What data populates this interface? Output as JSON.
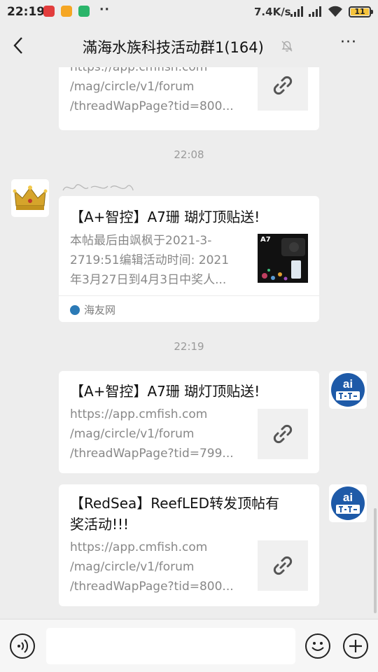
{
  "status_bar": {
    "time": "22:19",
    "more_dots": "··",
    "net_speed": "7.4K/s",
    "battery_level": "11"
  },
  "header": {
    "title": "滿海水族科技活动群1(164)",
    "more_label": "···"
  },
  "messages": [
    {
      "type": "link",
      "title": "",
      "desc_lines": [
        "https://app.cmfish.com",
        "/mag/circle/v1/forum",
        "/threadWapPage?tid=800..."
      ]
    },
    {
      "type": "time",
      "text": "22:08"
    },
    {
      "type": "article",
      "title": "【A+智控】A7珊 瑚灯顶贴送!",
      "desc_lines": [
        "本帖最后由飒枫于2021-3-",
        "2719:51编辑活动时间: 2021",
        "年3月27日到4月3日中奖人..."
      ],
      "thumb_label": "A7",
      "source": "海友网"
    },
    {
      "type": "time",
      "text": "22:19"
    },
    {
      "type": "link",
      "title": "【A+智控】A7珊 瑚灯顶贴送!",
      "desc_lines": [
        "https://app.cmfish.com",
        "/mag/circle/v1/forum",
        "/threadWapPage?tid=799..."
      ]
    },
    {
      "type": "link",
      "title_lines": [
        "【RedSea】ReefLED转发顶帖有",
        "奖活动!!!"
      ],
      "desc_lines": [
        "https://app.cmfish.com",
        "/mag/circle/v1/forum",
        "/threadWapPage?tid=800..."
      ]
    }
  ],
  "avatars": {
    "bot_text": "ai"
  },
  "colors": {
    "background": "#ededed",
    "card": "#ffffff",
    "avatar_blue": "#1e5aa8",
    "battery": "#f5c33b"
  },
  "icons": [
    "back-arrow-icon",
    "mute-bell-icon",
    "more-icon",
    "link-icon",
    "voice-icon",
    "emoji-icon",
    "plus-icon"
  ]
}
